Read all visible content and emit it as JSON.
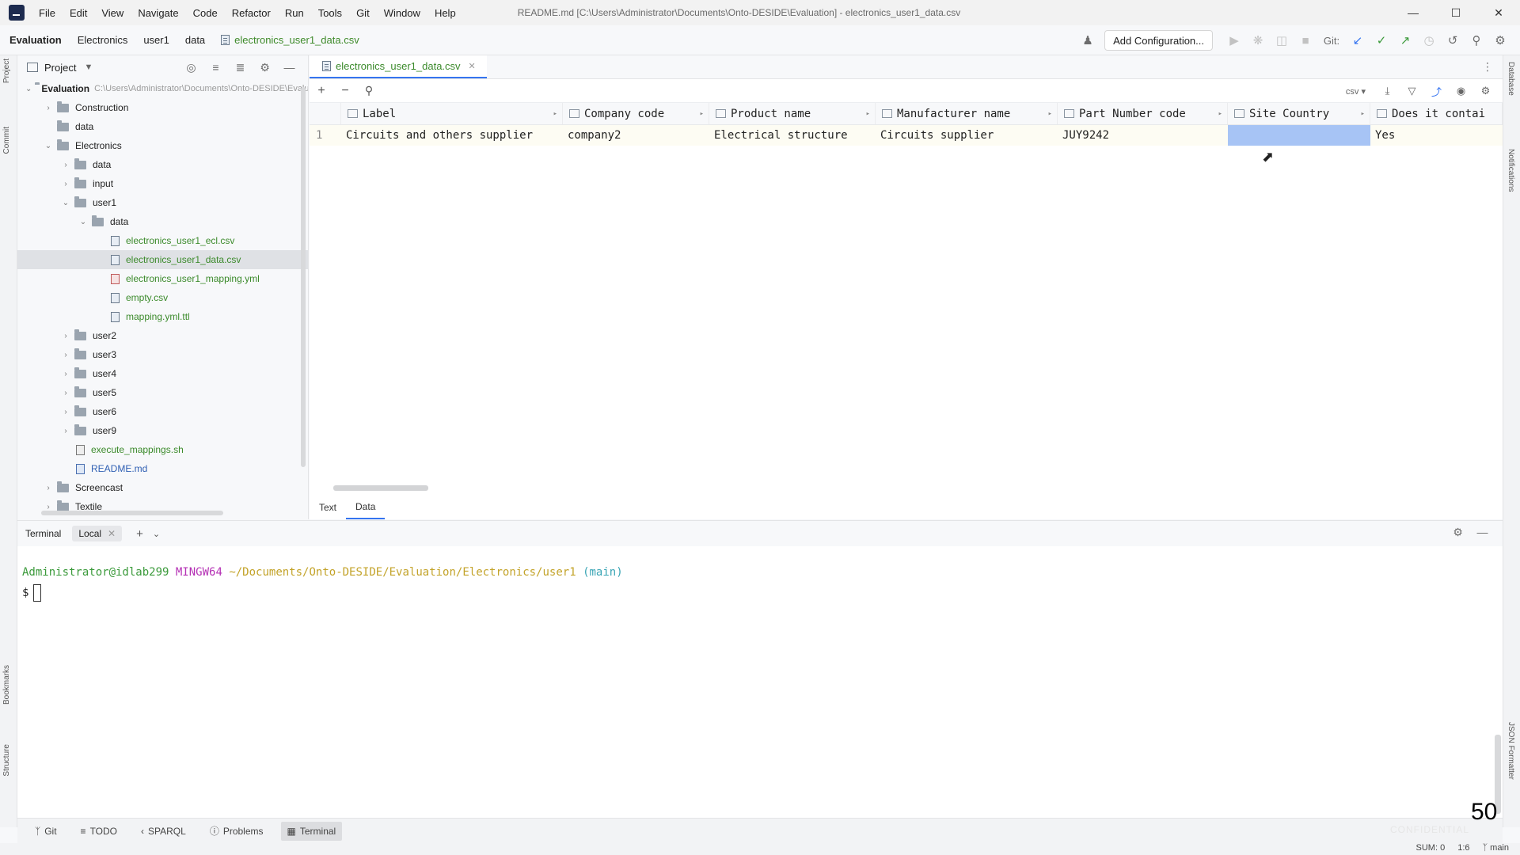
{
  "window": {
    "title": "README.md [C:\\Users\\Administrator\\Documents\\Onto-DESIDE\\Evaluation] - electronics_user1_data.csv",
    "menu": [
      "File",
      "Edit",
      "View",
      "Navigate",
      "Code",
      "Refactor",
      "Run",
      "Tools",
      "Git",
      "Window",
      "Help"
    ],
    "controls": {
      "minimize": "—",
      "maximize": "☐",
      "close": "✕"
    }
  },
  "navbar": {
    "breadcrumb": [
      "Evaluation",
      "Electronics",
      "user1",
      "data",
      "electronics_user1_data.csv"
    ],
    "add_configuration": "Add Configuration...",
    "git_label": "Git:"
  },
  "project": {
    "title": "Project",
    "tree": [
      {
        "label": "Evaluation",
        "path": "C:\\Users\\Administrator\\Documents\\Onto-DESIDE\\Evaluation",
        "depth": 0,
        "type": "folder",
        "expanded": true,
        "bold": true
      },
      {
        "label": "Construction",
        "depth": 1,
        "type": "folder",
        "expanded": false
      },
      {
        "label": "data",
        "depth": 1,
        "type": "folder",
        "leaf": true
      },
      {
        "label": "Electronics",
        "depth": 1,
        "type": "folder",
        "expanded": true
      },
      {
        "label": "data",
        "depth": 2,
        "type": "folder",
        "expanded": false
      },
      {
        "label": "input",
        "depth": 2,
        "type": "folder",
        "expanded": false
      },
      {
        "label": "user1",
        "depth": 2,
        "type": "folder",
        "expanded": true
      },
      {
        "label": "data",
        "depth": 3,
        "type": "folder",
        "expanded": true
      },
      {
        "label": "electronics_user1_ecl.csv",
        "depth": 4,
        "type": "csv",
        "green": true
      },
      {
        "label": "electronics_user1_data.csv",
        "depth": 4,
        "type": "csv",
        "green": true,
        "selected": true
      },
      {
        "label": "electronics_user1_mapping.yml",
        "depth": 4,
        "type": "yml",
        "green": true
      },
      {
        "label": "empty.csv",
        "depth": 4,
        "type": "csv",
        "green": true
      },
      {
        "label": "mapping.yml.ttl",
        "depth": 4,
        "type": "csv",
        "green": true
      },
      {
        "label": "user2",
        "depth": 2,
        "type": "folder",
        "expanded": false
      },
      {
        "label": "user3",
        "depth": 2,
        "type": "folder",
        "expanded": false
      },
      {
        "label": "user4",
        "depth": 2,
        "type": "folder",
        "expanded": false
      },
      {
        "label": "user5",
        "depth": 2,
        "type": "folder",
        "expanded": false
      },
      {
        "label": "user6",
        "depth": 2,
        "type": "folder",
        "expanded": false
      },
      {
        "label": "user9",
        "depth": 2,
        "type": "folder",
        "expanded": false
      },
      {
        "label": "execute_mappings.sh",
        "depth": 2,
        "type": "sh",
        "green": true
      },
      {
        "label": "README.md",
        "depth": 2,
        "type": "md",
        "blue": true
      },
      {
        "label": "Screencast",
        "depth": 1,
        "type": "folder",
        "expanded": false
      },
      {
        "label": "Textile",
        "depth": 1,
        "type": "folder",
        "expanded": false
      }
    ]
  },
  "editor": {
    "tab": "electronics_user1_data.csv",
    "format": "csv",
    "columns": [
      "Label",
      "Company code",
      "Product name",
      "Manufacturer name",
      "Part Number code",
      "Site Country",
      "Does it contai"
    ],
    "rows": [
      {
        "num": "1",
        "cells": [
          "Circuits and others supplier",
          "company2",
          "Electrical structure",
          "Circuits supplier",
          "JUY9242",
          "",
          "Yes"
        ]
      }
    ],
    "view_tabs": [
      "Text",
      "Data"
    ],
    "active_view": "Data"
  },
  "terminal": {
    "title": "Terminal",
    "tab": "Local",
    "user": "Administrator@idlab299",
    "system": "MINGW64",
    "path": "~/Documents/Onto-DESIDE/Evaluation/Electronics/user1",
    "branch": "(main)",
    "prompt": "$"
  },
  "toolwindows": [
    "Git",
    "TODO",
    "SPARQL",
    "Problems",
    "Terminal"
  ],
  "strips": {
    "left": [
      "Project",
      "Commit",
      "Bookmarks",
      "Structure"
    ],
    "right": [
      "Database",
      "Notifications",
      "JSON Formatter"
    ]
  },
  "status": {
    "sum": "SUM: 0",
    "position": "1:6",
    "branch": "main"
  },
  "overlay": {
    "slide_number": "50",
    "watermark": "CONFIDENTIAL"
  }
}
